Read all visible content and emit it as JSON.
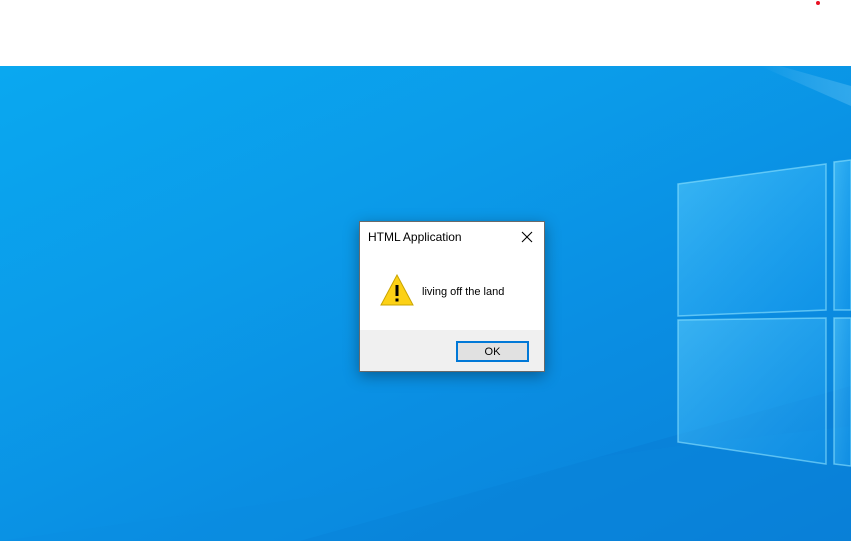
{
  "dialog": {
    "title": "HTML Application",
    "message": "living off the land",
    "ok_label": "OK",
    "icon": "warning-icon",
    "close_icon": "close-icon"
  },
  "colors": {
    "desktop_accent": "#0a8fe3",
    "button_focus": "#0078d7",
    "warning_yellow": "#fcd116"
  }
}
